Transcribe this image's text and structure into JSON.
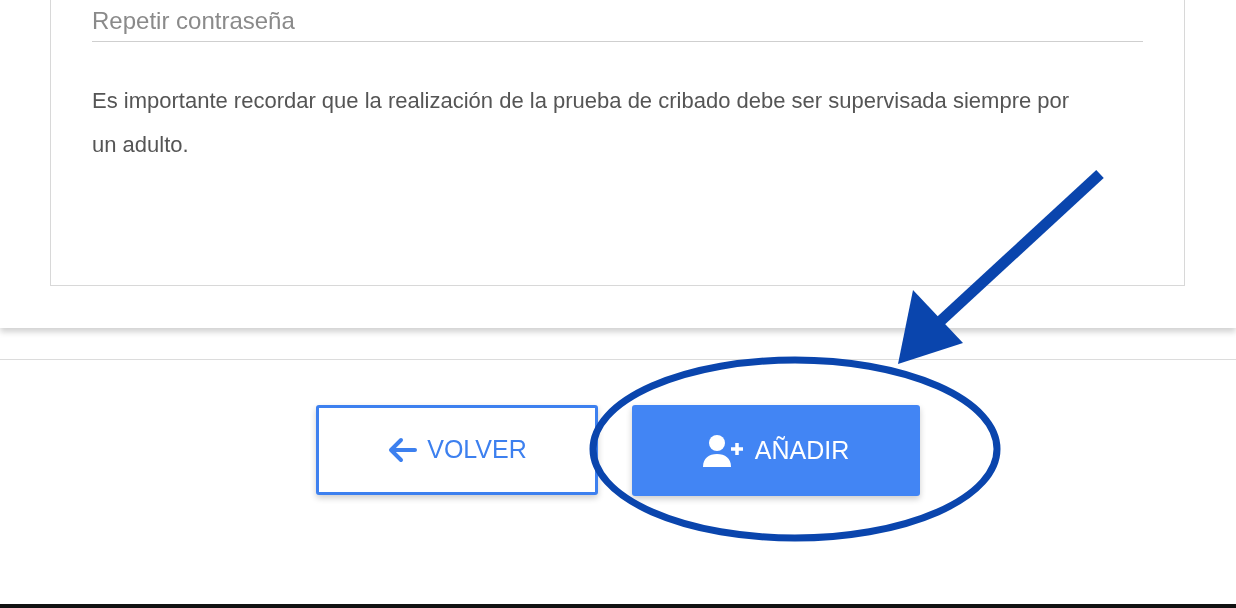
{
  "form": {
    "repeat_password": {
      "placeholder": "Repetir contraseña"
    },
    "notice": "Es importante recordar que la realización de la prueba de cribado debe ser supervisada siempre por un adulto."
  },
  "buttons": [
    {
      "kind": "outline",
      "label": "VOLVER"
    },
    {
      "kind": "filled",
      "label": "AÑADIR"
    }
  ]
}
